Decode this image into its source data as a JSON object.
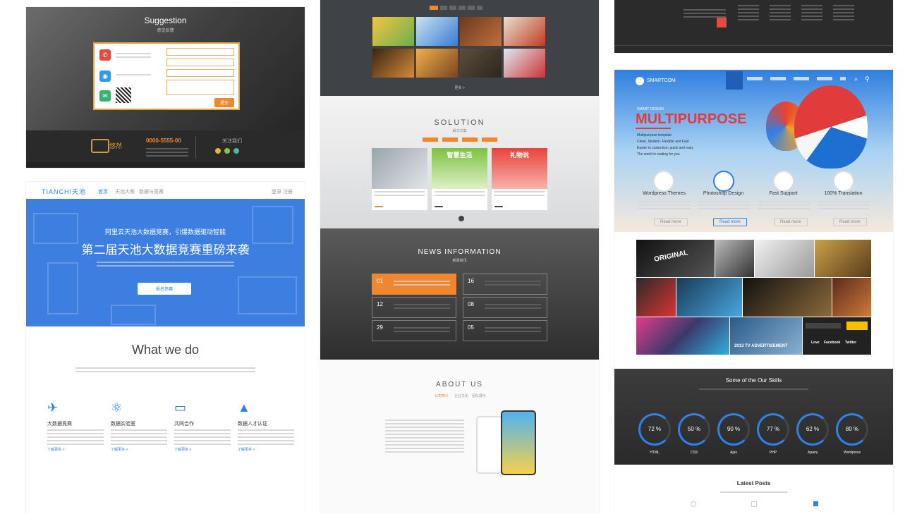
{
  "card1": {
    "title": "Suggestion",
    "subtitle": "意见反馈",
    "submit": "提交",
    "phone": "0000-5555-00",
    "logo": "悠然",
    "follow": "关注我们"
  },
  "card2": {
    "brand": "TIANCHI天池",
    "nav": [
      "首页",
      "天池大赛",
      "数据与竞赛"
    ],
    "nav_right": [
      "登录",
      "注册"
    ],
    "hero_small": "阿里云天池大数据竞赛，引爆数据驱动智能",
    "hero_title": "第二届天池大数据竞赛重磅来袭",
    "hero_button": "报名参赛",
    "section_title": "What we do",
    "features": [
      {
        "title": "大数据竞赛",
        "more": "了解更多 >"
      },
      {
        "title": "数据实验室",
        "more": "了解更多 >"
      },
      {
        "title": "共同合作",
        "more": "了解更多 >"
      },
      {
        "title": "数据人才认证",
        "more": "了解更多 >"
      }
    ]
  },
  "card3": {
    "solution_title": "SOLUTION",
    "solution_sub": "解决方案",
    "solution_cards": [
      "智慧生活",
      "礼物说"
    ],
    "news_title": "NEWS INFORMATION",
    "news_sub": "新闻资讯",
    "news_left": [
      "01",
      "12",
      "29"
    ],
    "news_right": [
      "16",
      "08",
      "05"
    ],
    "about_title": "ABOUT US",
    "about_tabs": [
      "公司简介",
      "企业文化",
      "团队展示"
    ],
    "more": "更多 >",
    "view": "查看"
  },
  "card4": {
    "brand": "SMARTCOM",
    "hero_small": "SMART DESIGN",
    "hero_title": "MULTIPURPOSE",
    "hero_lines": [
      "Multipurpose template",
      "Clean, Modern, Flexible and Fast",
      "Easier to customize, quick and easy",
      "The world is waiting for you"
    ],
    "services": [
      {
        "title": "Wordpress Themes",
        "btn": "Read more"
      },
      {
        "title": "Photoshop Design",
        "btn": "Read more"
      },
      {
        "title": "Fast Support",
        "btn": "Read more"
      },
      {
        "title": "100% Translation",
        "btn": "Read more"
      }
    ],
    "skills_title": "Some of the Our Skills",
    "skills": [
      {
        "value": "72 %",
        "label": "HTML",
        "pct": 72
      },
      {
        "value": "50 %",
        "label": "CSS",
        "pct": 50
      },
      {
        "value": "90 %",
        "label": "Ajax",
        "pct": 90
      },
      {
        "value": "77 %",
        "label": "PHP",
        "pct": 77
      },
      {
        "value": "62 %",
        "label": "Jquery",
        "pct": 62
      },
      {
        "value": "80 %",
        "label": "Wordpress",
        "pct": 80
      }
    ],
    "latest_title": "Latest Posts",
    "photo_caption": "2013 TV ADVERTISEMENT",
    "social": [
      "Love",
      "Facebook",
      "Twitter"
    ],
    "photo_text": "ORIGINAL"
  },
  "colors": {
    "orange": "#f0862f",
    "blue": "#2f80e8",
    "red": "#e44b3c",
    "green": "#34b36b"
  }
}
